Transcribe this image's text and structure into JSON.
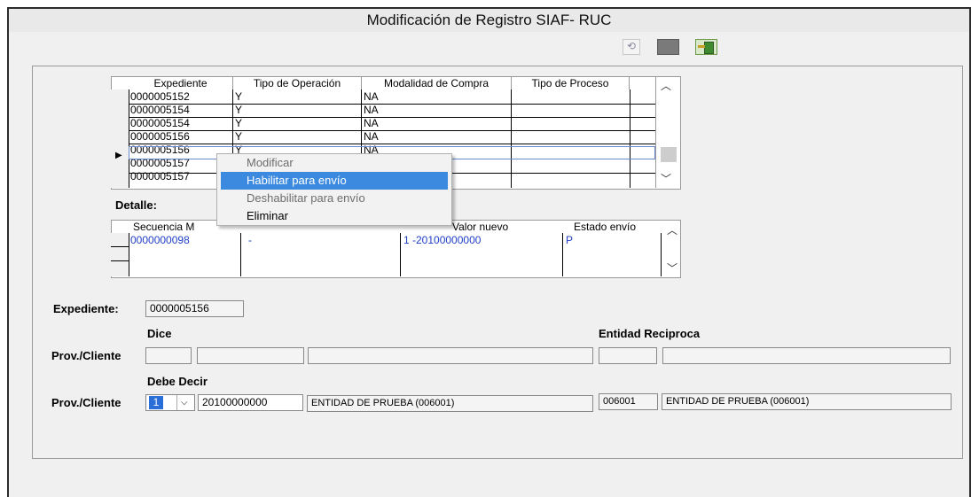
{
  "window": {
    "title": "Modificación de Registro SIAF- RUC"
  },
  "toolbar": {
    "undo_icon": "undo-icon",
    "stop_icon": "square-icon",
    "exit_icon": "exit-door-icon"
  },
  "grid1": {
    "headers": [
      "Expediente",
      "Tipo de Operación",
      "Modalidad de Compra",
      "Tipo de Proceso"
    ],
    "rows": [
      [
        "0000005152",
        "Y",
        "NA",
        ""
      ],
      [
        "0000005154",
        "Y",
        "NA",
        ""
      ],
      [
        "0000005154",
        "Y",
        "NA",
        ""
      ],
      [
        "0000005156",
        "Y",
        "NA",
        ""
      ],
      [
        "0000005156",
        "Y",
        "NA",
        ""
      ],
      [
        "0000005157",
        "",
        "",
        ""
      ],
      [
        "0000005157",
        "",
        "",
        ""
      ]
    ],
    "current_row_marker": "▶"
  },
  "context_menu": {
    "items": [
      "Modificar",
      "Habilitar para envío",
      "Deshabilitar para envío",
      "Eliminar"
    ]
  },
  "detalle": {
    "label": "Detalle:",
    "headers": [
      "Secuencia M",
      "",
      "Valor nuevo",
      "Estado envío"
    ],
    "rows": [
      [
        "0000000098",
        "-",
        "1 -20100000000",
        "P"
      ]
    ]
  },
  "expediente": {
    "label": "Expediente:",
    "value": "0000005156"
  },
  "dice": {
    "label": "Dice",
    "prov_label": "Prov./Cliente"
  },
  "entidad": {
    "label": "Entidad Reciproca"
  },
  "debe": {
    "label": "Debe Decir",
    "prov_label": "Prov./Cliente",
    "select_value": "1",
    "ruc": "20100000000",
    "nombre": "ENTIDAD DE PRUEBA (006001)",
    "entidad_code": "006001",
    "entidad_nombre": "ENTIDAD DE PRUEBA (006001)"
  }
}
